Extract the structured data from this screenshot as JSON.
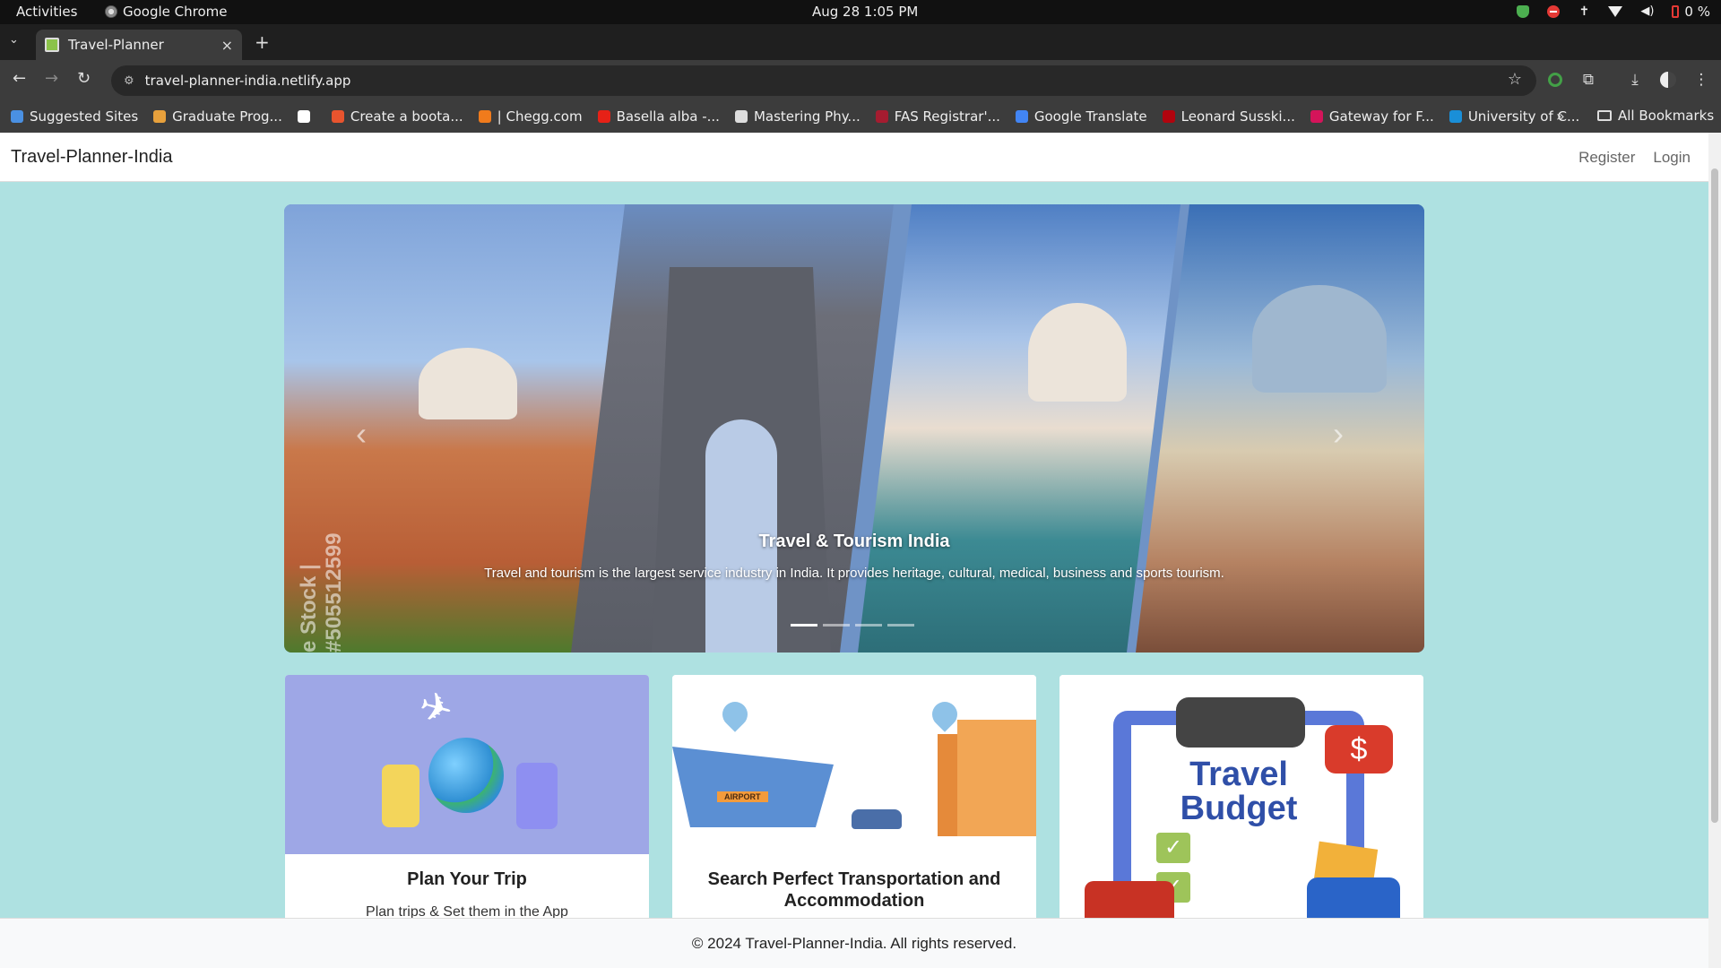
{
  "os": {
    "activities": "Activities",
    "app_name": "Google Chrome",
    "clock": "Aug 28  1:05 PM",
    "battery": "0 %"
  },
  "browser": {
    "tab_title": "Travel-Planner",
    "tab_close": "×",
    "new_tab": "+",
    "url": "travel-planner-india.netlify.app",
    "bookmarks": [
      {
        "label": "Suggested Sites",
        "color": "#4a90e2"
      },
      {
        "label": "Graduate Prog...",
        "color": "#e8a13c"
      },
      {
        "label": "",
        "color": "#ffffff"
      },
      {
        "label": "Create a boota...",
        "color": "#e8542e"
      },
      {
        "label": "| Chegg.com",
        "color": "#f07b1c"
      },
      {
        "label": "Basella alba -...",
        "color": "#e62117"
      },
      {
        "label": "Mastering Phy...",
        "color": "#dddddd"
      },
      {
        "label": "FAS Registrar'...",
        "color": "#a51c30"
      },
      {
        "label": "Google Translate",
        "color": "#4285f4"
      },
      {
        "label": "Leonard Susski...",
        "color": "#b1040e"
      },
      {
        "label": "Gateway for F...",
        "color": "#d4145a"
      },
      {
        "label": "University of C...",
        "color": "#1a8fd8"
      }
    ],
    "bookmarks_more": "»",
    "all_bookmarks": "All Bookmarks"
  },
  "site": {
    "brand": "Travel-Planner-India",
    "nav": {
      "register": "Register",
      "login": "Login"
    },
    "carousel": {
      "watermark": "e Stock | #505512599",
      "caption_title": "Travel & Tourism India",
      "caption_text": "Travel and tourism is the largest service industry in India. It provides heritage, cultural, medical, business and sports tourism.",
      "prev": "‹",
      "next": "›",
      "slide_count": 4,
      "active_slide": 1
    },
    "cards": [
      {
        "title": "Plan Your Trip",
        "text": "Plan trips & Set them in the App"
      },
      {
        "title": "Search Perfect Transportation and Accommodation",
        "text": ""
      },
      {
        "title": "",
        "text": "",
        "image_text": "Travel Budget",
        "image_symbol": "$"
      }
    ],
    "card2_sign": "AIRPORT",
    "footer": "© 2024 Travel-Planner-India. All rights reserved."
  },
  "colors": {
    "page_bg": "#aee1e1",
    "navbar_bg": "#ffffff",
    "footer_bg": "#f8f9fa"
  }
}
